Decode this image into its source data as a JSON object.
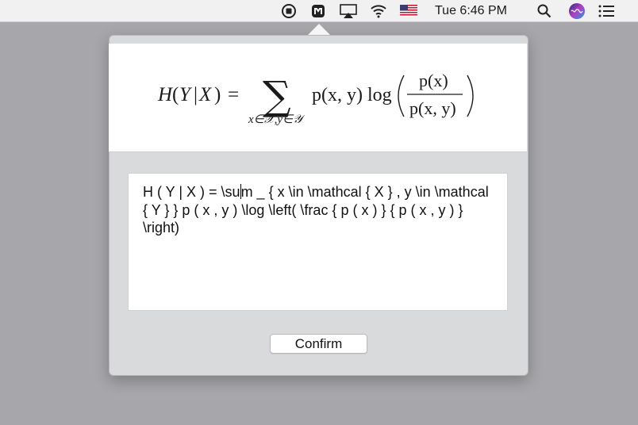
{
  "menubar": {
    "clock": "Tue 6:46 PM",
    "icons": [
      "record-icon",
      "mathpix-icon",
      "airplay-icon",
      "wifi-icon",
      "us-flag-icon",
      "search-icon",
      "siri-icon",
      "notification-center-icon"
    ]
  },
  "formula": {
    "lhs_H": "H",
    "lhs_open": "(",
    "lhs_Y": "Y",
    "lhs_bar": "|",
    "lhs_X": "X",
    "lhs_close": ")",
    "equals": "=",
    "sum": "∑",
    "subscript": "x∈𝒳,y∈𝒴",
    "p_term": "p(x, y) log",
    "numerator": "p(x)",
    "denominator": "p(x, y)"
  },
  "editor": {
    "text_before_caret": "H ( Y | X ) = \\su",
    "text_after_caret": "m _ { x \\in \\mathcal { X } , y \\in \\mathcal { Y } } p ( x , y ) \\log \\left( \\frac { p ( x ) } { p ( x , y ) } \\right)"
  },
  "confirm_label": "Confirm"
}
